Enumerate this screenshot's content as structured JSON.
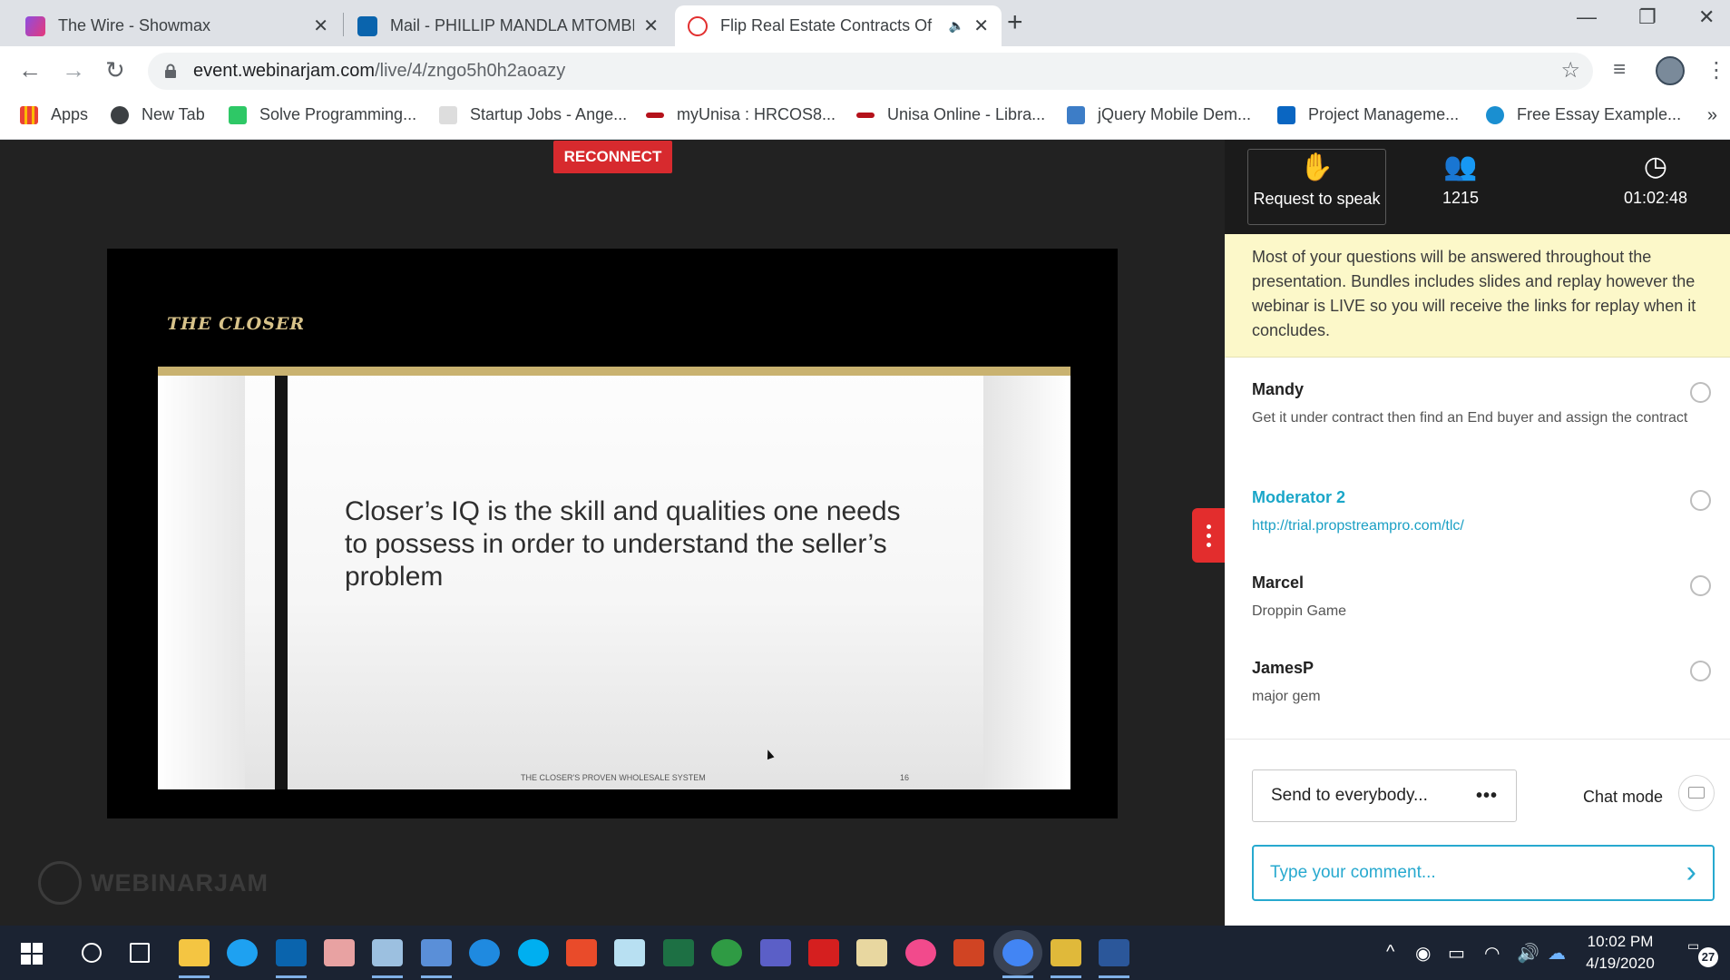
{
  "browser": {
    "tabs": [
      {
        "title": "The Wire - Showmax",
        "icon": "showmax-icon",
        "color": "#e6397a",
        "active": false
      },
      {
        "title": "Mail - PHILLIP MANDLA MTOMBE",
        "icon": "outlook-icon",
        "color": "#0a64ad",
        "active": false
      },
      {
        "title": "Flip Real Estate Contracts Of",
        "icon": "webinarjam-icon",
        "color": "#e22f2f",
        "active": true
      }
    ],
    "close_glyph": "✕",
    "new_tab_glyph": "+",
    "url_host": "event.webinarjam.com",
    "url_path": "/live/4/zngo5h0h2aoazy"
  },
  "bookmarks": [
    {
      "label": "Apps",
      "color": "#4285f4"
    },
    {
      "label": "New Tab",
      "color": "#3c4043"
    },
    {
      "label": "Solve Programming...",
      "color": "#2ec866"
    },
    {
      "label": "Startup Jobs - Ange...",
      "color": "#333333"
    },
    {
      "label": "myUnisa : HRCOS8...",
      "color": "#b5121b"
    },
    {
      "label": "Unisa Online - Libra...",
      "color": "#b5121b"
    },
    {
      "label": "jQuery Mobile Dem...",
      "color": "#3d7dc7"
    },
    {
      "label": "Project Manageme...",
      "color": "#0a66c2"
    },
    {
      "label": "Free Essay Example...",
      "color": "#1a8fd1"
    }
  ],
  "bookmarks_more": "»",
  "stage": {
    "reconnect_label": "RECONNECT",
    "closer_logo": "THE CLOSER",
    "slide_text": "Closer’s IQ is the skill and qualities one needs to possess in order to understand the seller’s problem",
    "slide_footer": "THE CLOSER'S PROVEN WHOLESALE SYSTEM",
    "slide_page": "16",
    "brand": "WEBINARJAM"
  },
  "panel": {
    "request_label": "Request to speak",
    "attendees": "1215",
    "elapsed": "01:02:48",
    "notice": "Most of your questions will be answered throughout the presentation. Bundles includes slides and replay however the webinar is LIVE so you will receive the links for replay when it concludes.",
    "messages": [
      {
        "name": "Mandy",
        "text": "Get it under contract then find an End buyer and assign the contract",
        "moderator": false
      },
      {
        "name": "Moderator 2",
        "text": "http://trial.propstreampro.com/tlc/",
        "moderator": true
      },
      {
        "name": "Marcel",
        "text": "Droppin Game",
        "moderator": false
      },
      {
        "name": "JamesP",
        "text": "major gem",
        "moderator": false
      }
    ],
    "send_to": "Send to everybody...",
    "send_to_more": "•••",
    "chat_mode": "Chat mode",
    "comment_placeholder": "Type your comment..."
  },
  "taskbar": {
    "time": "10:02 PM",
    "date": "4/19/2020",
    "notifications": "27",
    "apps": [
      {
        "name": "search",
        "color": "#ffffff"
      },
      {
        "name": "task-view",
        "color": "#ffffff"
      },
      {
        "name": "file-explorer",
        "color": "#f4c542"
      },
      {
        "name": "internet-explorer",
        "color": "#1ea1f1"
      },
      {
        "name": "outlook",
        "color": "#0a64ad"
      },
      {
        "name": "paint",
        "color": "#e8a2a2"
      },
      {
        "name": "performance-monitor",
        "color": "#9cc0e0"
      },
      {
        "name": "network-tool",
        "color": "#5a8fd8"
      },
      {
        "name": "edge",
        "color": "#1f8ae0"
      },
      {
        "name": "skype",
        "color": "#00aff0"
      },
      {
        "name": "windows-app",
        "color": "#e94b2a"
      },
      {
        "name": "notes-app",
        "color": "#b8e0f2"
      },
      {
        "name": "excel",
        "color": "#1d7044"
      },
      {
        "name": "xbox",
        "color": "#2f9b44"
      },
      {
        "name": "teams",
        "color": "#5b5fc7"
      },
      {
        "name": "acrobat",
        "color": "#d51f1f"
      },
      {
        "name": "editor-app",
        "color": "#e8d7a0"
      },
      {
        "name": "itunes",
        "color": "#f24a8c"
      },
      {
        "name": "powerpoint",
        "color": "#d04423"
      },
      {
        "name": "chrome",
        "color": "#4285f4"
      },
      {
        "name": "archive-app",
        "color": "#e0b93a"
      },
      {
        "name": "word",
        "color": "#2b579a"
      }
    ]
  }
}
